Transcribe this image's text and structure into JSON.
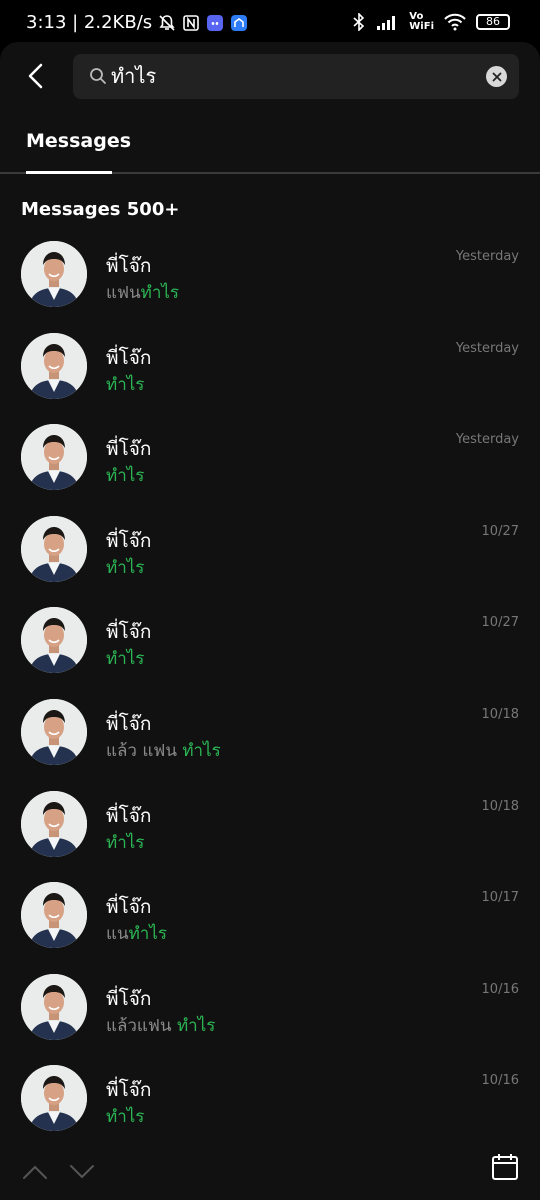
{
  "status_bar": {
    "time_speed": "3:13 | 2.2KB/s",
    "battery": "86",
    "vowifi": "Vo\nWiFi"
  },
  "search": {
    "query": "ทำไร"
  },
  "tabs": [
    {
      "label": "Messages"
    }
  ],
  "section": {
    "title": "Messages 500+"
  },
  "accent_color": "#2bb453",
  "results": [
    {
      "name": "พี่โจ๊ก",
      "pre": "แฟน",
      "match": "ทำไร",
      "time": "Yesterday"
    },
    {
      "name": "พี่โจ๊ก",
      "pre": "",
      "match": "ทำไร",
      "time": "Yesterday"
    },
    {
      "name": "พี่โจ๊ก",
      "pre": "",
      "match": "ทำไร",
      "time": "Yesterday"
    },
    {
      "name": "พี่โจ๊ก",
      "pre": "",
      "match": "ทำไร",
      "time": "10/27"
    },
    {
      "name": "พี่โจ๊ก",
      "pre": "",
      "match": "ทำไร",
      "time": "10/27"
    },
    {
      "name": "พี่โจ๊ก",
      "pre": "แล้ว แฟน ",
      "match": "ทำไร",
      "time": "10/18"
    },
    {
      "name": "พี่โจ๊ก",
      "pre": "",
      "match": "ทำไร",
      "time": "10/18"
    },
    {
      "name": "พี่โจ๊ก",
      "pre": "แน",
      "match": "ทำไร",
      "time": "10/17"
    },
    {
      "name": "พี่โจ๊ก",
      "pre": "แล้วแฟน ",
      "match": "ทำไร",
      "time": "10/16"
    },
    {
      "name": "พี่โจ๊ก",
      "pre": "",
      "match": "ทำไร",
      "time": "10/16"
    }
  ]
}
